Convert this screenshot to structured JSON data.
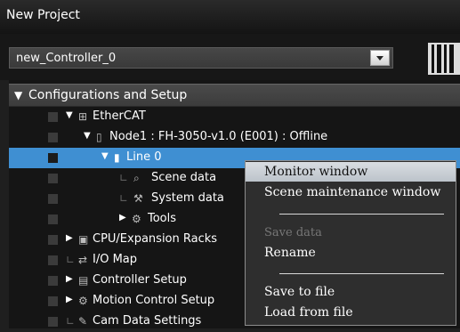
{
  "window": {
    "title": "New Project"
  },
  "controller": {
    "selected": "new_Controller_0"
  },
  "tree": {
    "group_label": "Configurations and Setup",
    "items": [
      {
        "label": "EtherCAT"
      },
      {
        "label": "Node1 : FH-3050-v1.0 (E001) : Offline"
      },
      {
        "label": "Line 0"
      },
      {
        "label": "Scene data"
      },
      {
        "label": "System data"
      },
      {
        "label": "Tools"
      },
      {
        "label": "CPU/Expansion Racks"
      },
      {
        "label": "I/O Map"
      },
      {
        "label": "Controller Setup"
      },
      {
        "label": "Motion Control Setup"
      },
      {
        "label": "Cam Data Settings"
      }
    ]
  },
  "context_menu": {
    "items": [
      {
        "label": "Monitor window"
      },
      {
        "label": "Scene maintenance window"
      },
      {
        "label": "Save data"
      },
      {
        "label": "Rename"
      },
      {
        "label": "Save to file"
      },
      {
        "label": "Load from file"
      }
    ]
  },
  "icons": {
    "expanded": "triangle-down",
    "collapsed": "triangle-right",
    "highlight_color": "#3f8fd2"
  }
}
